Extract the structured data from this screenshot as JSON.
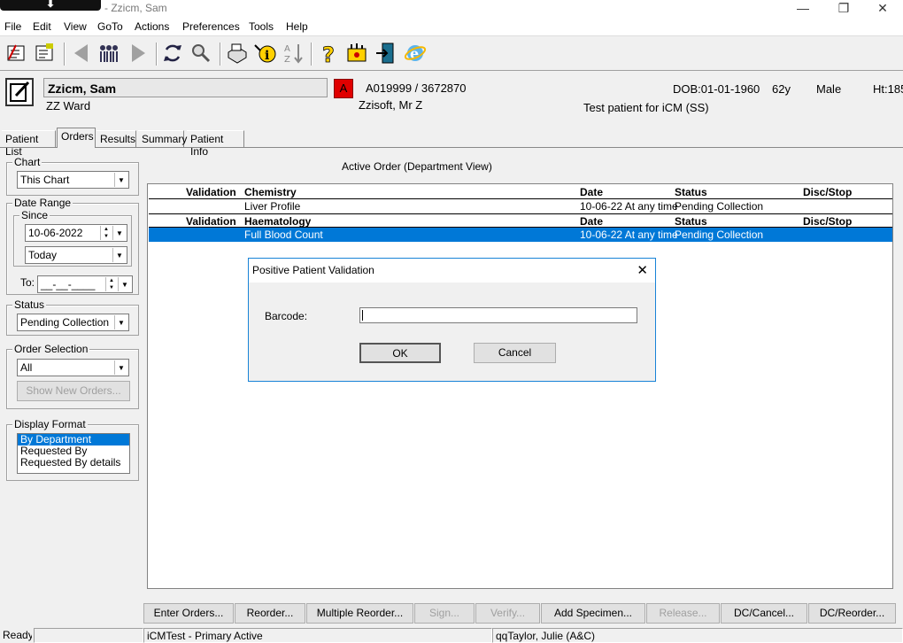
{
  "window": {
    "title": "- Zzicm, Sam",
    "minimize_glyph": "—",
    "restore_glyph": "❐",
    "close_glyph": "✕"
  },
  "menu": [
    "File",
    "Edit",
    "View",
    "GoTo",
    "Actions",
    "Preferences",
    "Tools",
    "Help"
  ],
  "toolbar": {
    "icons": [
      "patient-list-icon",
      "patient-chart-icon",
      "back-icon",
      "patients-icon",
      "forward-icon",
      "refresh-icon",
      "search-icon",
      "print-icon",
      "info-icon",
      "sort-icon",
      "help-icon",
      "settings-icon",
      "exit-icon",
      "browser-icon"
    ]
  },
  "patient": {
    "name": "Zzicm, Sam",
    "ward": "ZZ Ward",
    "alert": "A",
    "ids": "A019999 / 3672870",
    "consultant": "Zzisoft, Mr Z",
    "dob": "DOB:01-01-1960",
    "age": "62y",
    "sex": "Male",
    "height": "Ht:185",
    "note": "Test patient for iCM (SS)"
  },
  "tabs": [
    "Patient List",
    "Orders",
    "Results",
    "Summary",
    "Patient Info"
  ],
  "filters": {
    "chart_label": "Chart",
    "chart_value": "This Chart",
    "date_range_label": "Date Range",
    "since_label": "Since",
    "since_date": "10-06-2022",
    "since_preset": "Today",
    "to_label": "To:",
    "to_date": "__-__-____",
    "status_label": "Status",
    "status_value": "Pending Collection",
    "order_selection_label": "Order Selection",
    "order_selection_value": "All",
    "show_new_orders": "Show New Orders...",
    "display_format_label": "Display Format",
    "display_format_options": [
      "By Department",
      "Requested By",
      "Requested By details"
    ]
  },
  "orders": {
    "heading": "Active Order (Department View)",
    "groups": [
      {
        "header": {
          "validation": "Validation",
          "department": "Chemistry",
          "date": "Date",
          "status": "Status",
          "disc": "Disc/Stop"
        },
        "rows": [
          {
            "validation": "",
            "name": "Liver Profile",
            "date": "10-06-22 At any time",
            "status": "Pending Collection",
            "disc": ""
          }
        ]
      },
      {
        "header": {
          "validation": "Validation",
          "department": "Haematology",
          "date": "Date",
          "status": "Status",
          "disc": "Disc/Stop"
        },
        "rows": [
          {
            "validation": "",
            "name": "Full Blood Count",
            "date": "10-06-22 At any time",
            "status": "Pending Collection",
            "disc": ""
          }
        ]
      }
    ]
  },
  "dialog": {
    "title": "Positive Patient Validation",
    "barcode_label": "Barcode:",
    "barcode_value": "",
    "ok": "OK",
    "cancel": "Cancel"
  },
  "bottom_buttons": [
    {
      "label": "Enter Orders...",
      "enabled": true
    },
    {
      "label": "Reorder...",
      "enabled": true
    },
    {
      "label": "Multiple Reorder...",
      "enabled": true
    },
    {
      "label": "Sign...",
      "enabled": false
    },
    {
      "label": "Verify...",
      "enabled": false
    },
    {
      "label": "Add Specimen...",
      "enabled": true
    },
    {
      "label": "Release...",
      "enabled": false
    },
    {
      "label": "DC/Cancel...",
      "enabled": true
    },
    {
      "label": "DC/Reorder...",
      "enabled": true
    }
  ],
  "status_bar": {
    "ready": "Ready",
    "system": "iCMTest - Primary Active",
    "user": "qqTaylor, Julie  (A&C)"
  },
  "colors": {
    "selection": "#0078d7",
    "alert": "#e00000",
    "dialog_border": "#1883d7"
  }
}
